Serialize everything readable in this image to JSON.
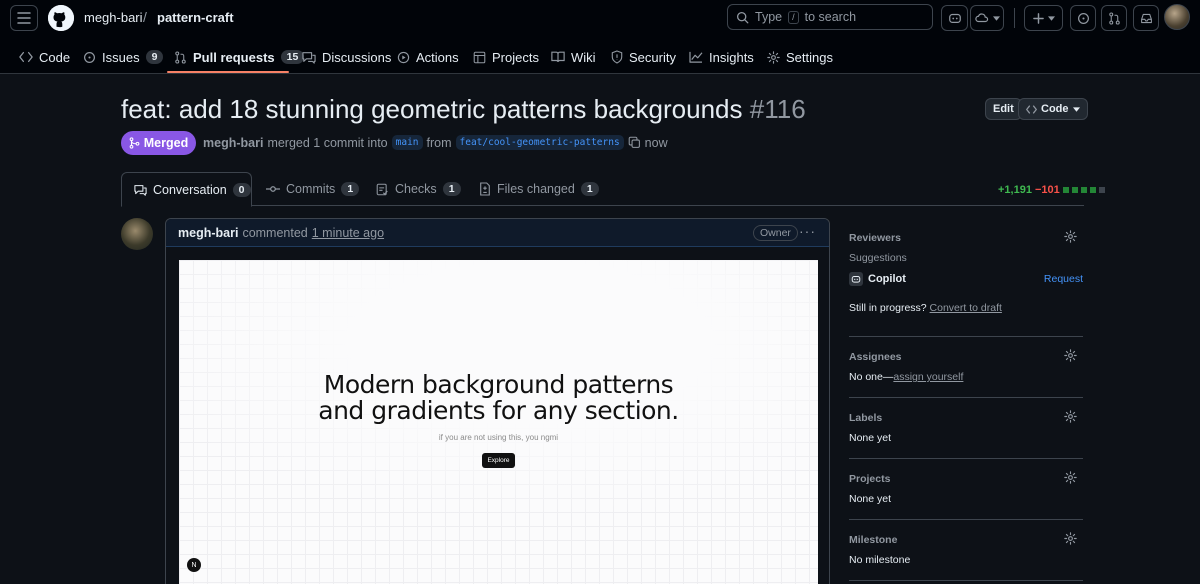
{
  "topbar": {
    "owner": "megh-bari",
    "separator": "/",
    "repo": "pattern-craft",
    "search_type": "Type",
    "search_key": "/",
    "search_suffix": "to search"
  },
  "repo_nav": {
    "tabs": [
      {
        "label": "Code",
        "icon": "code-icon"
      },
      {
        "label": "Issues",
        "icon": "issue-icon",
        "count": "9"
      },
      {
        "label": "Pull requests",
        "icon": "pull-request-icon",
        "count": "15"
      },
      {
        "label": "Discussions",
        "icon": "discussion-icon"
      },
      {
        "label": "Actions",
        "icon": "play-icon"
      },
      {
        "label": "Projects",
        "icon": "table-icon"
      },
      {
        "label": "Wiki",
        "icon": "book-icon"
      },
      {
        "label": "Security",
        "icon": "shield-icon"
      },
      {
        "label": "Insights",
        "icon": "graph-icon"
      },
      {
        "label": "Settings",
        "icon": "gear-icon"
      }
    ]
  },
  "pr": {
    "title": "feat: add 18 stunning geometric patterns backgrounds",
    "number": "#116",
    "state": "Merged",
    "author": "megh-bari",
    "action": "merged 1 commit into",
    "base_branch": "main",
    "from_word": "from",
    "head_branch": "feat/cool-geometric-patterns",
    "time": "now",
    "edit_label": "Edit",
    "code_label": "Code"
  },
  "pr_tabs": [
    {
      "label": "Conversation",
      "count": "0"
    },
    {
      "label": "Commits",
      "count": "1"
    },
    {
      "label": "Checks",
      "count": "1"
    },
    {
      "label": "Files changed",
      "count": "1"
    }
  ],
  "diffstat": {
    "additions": "+1,191",
    "deletions": "−101"
  },
  "comment": {
    "author": "megh-bari",
    "verb": "commented",
    "time": "1 minute ago",
    "badge": "Owner",
    "preview": {
      "heading_line1": "Modern background patterns",
      "heading_line2": "and gradients for any section.",
      "subtitle": "if you are not using this, you ngmi",
      "button": "Explore",
      "badge": "N"
    }
  },
  "sidebar": {
    "reviewers": {
      "label": "Reviewers",
      "suggestions": "Suggestions",
      "copilot": "Copilot",
      "request": "Request",
      "progress_text": "Still in progress?",
      "convert": "Convert to draft"
    },
    "assignees": {
      "label": "Assignees",
      "value": "No one—",
      "link": "assign yourself"
    },
    "labels": {
      "label": "Labels",
      "value": "None yet"
    },
    "projects": {
      "label": "Projects",
      "value": "None yet"
    },
    "milestone": {
      "label": "Milestone",
      "value": "No milestone"
    }
  },
  "colors": {
    "merged": "#8957e5",
    "accent": "#f78166",
    "link": "#4493f8",
    "addition": "#3fb950",
    "deletion": "#f85149"
  }
}
